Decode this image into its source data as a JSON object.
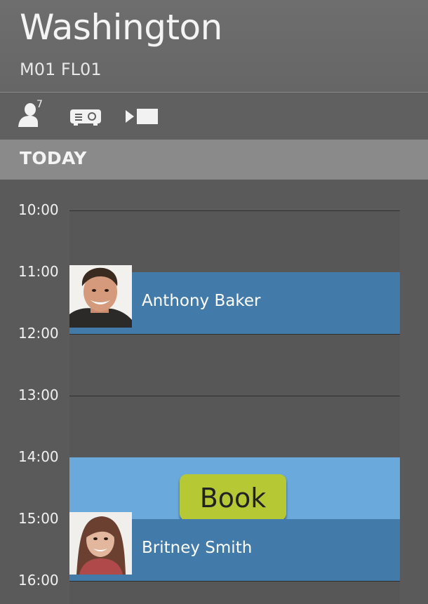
{
  "room": {
    "name": "Washington",
    "code": "M01 FL01"
  },
  "amenities": [
    {
      "icon": "person-icon",
      "capacity": "7"
    },
    {
      "icon": "projector-icon"
    },
    {
      "icon": "video-camera-icon"
    }
  ],
  "day": {
    "label": "TODAY"
  },
  "hours": [
    "10:00",
    "11:00",
    "12:00",
    "13:00",
    "14:00",
    "15:00",
    "16:00"
  ],
  "bookings": [
    {
      "name": "Anthony Baker",
      "start": "11:00",
      "end": "12:00",
      "avatar": "man-photo"
    },
    {
      "name": "Britney Smith",
      "start": "15:00",
      "end": "16:00",
      "avatar": "woman-photo"
    }
  ],
  "free_slot": {
    "start": "14:00",
    "end": "15:00"
  },
  "book_button": {
    "label": "Book",
    "color": "#b6c935"
  },
  "colors": {
    "booking": "#427aa9",
    "free_slot": "#6aa9dc",
    "header": "#666666",
    "day_bar": "#8a8a8a"
  }
}
